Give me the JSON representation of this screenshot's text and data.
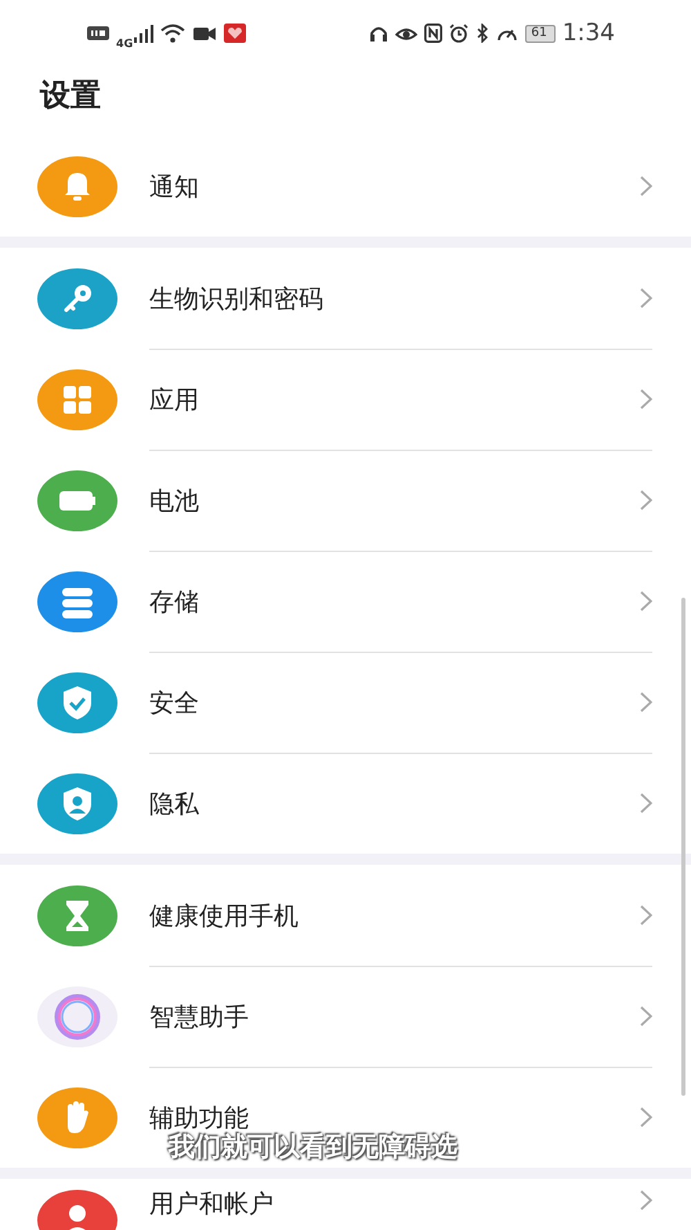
{
  "status_bar": {
    "network": "4G",
    "battery": "61",
    "time": "1:34"
  },
  "title": "设置",
  "groups": [
    {
      "items": [
        {
          "label": "通知"
        }
      ]
    },
    {
      "items": [
        {
          "label": "生物识别和密码"
        },
        {
          "label": "应用"
        },
        {
          "label": "电池"
        },
        {
          "label": "存储"
        },
        {
          "label": "安全"
        },
        {
          "label": "隐私"
        }
      ]
    },
    {
      "items": [
        {
          "label": "健康使用手机"
        },
        {
          "label": "智慧助手"
        },
        {
          "label": "辅助功能"
        }
      ]
    },
    {
      "items": [
        {
          "label": "用户和帐户"
        }
      ]
    }
  ],
  "caption": "我们就可以看到无障碍选"
}
